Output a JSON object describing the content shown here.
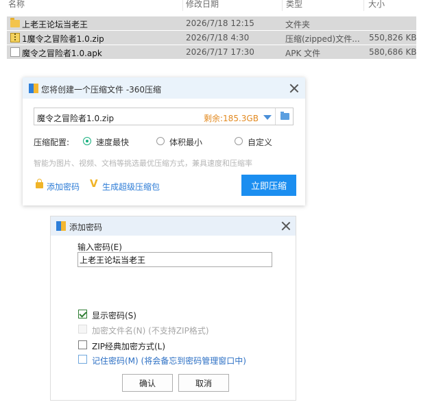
{
  "explorer": {
    "columns": [
      "名称",
      "修改日期",
      "类型",
      "大小"
    ],
    "files": [
      {
        "name": "上老王论坛当老王",
        "date": "2026/7/18 12:15",
        "type": "文件夹",
        "size": "",
        "icon": "folder-icon"
      },
      {
        "name": "1魔令之冒险者1.0.zip",
        "date": "2026/7/18 4:30",
        "type": "压缩(zipped)文件...",
        "size": "550,826 KB",
        "icon": "zip-icon"
      },
      {
        "name": "魔令之冒险者1.0.apk",
        "date": "2026/7/17 17:30",
        "type": "APK 文件",
        "size": "580,686 KB",
        "icon": "document-icon"
      }
    ]
  },
  "compress_dialog": {
    "title": "您将创建一个压缩文件 -360压缩",
    "filename": "魔令之冒险者1.0.zip",
    "remaining": "剩余:185.3GB",
    "config_label": "压缩配置:",
    "options": [
      "速度最快",
      "体积最小",
      "自定义"
    ],
    "selected_option": "速度最快",
    "hint": "智能为图片、视频、文档等挑选最优压缩方式，兼具速度和压缩率",
    "add_password": "添加密码",
    "super_compress": "生成超级压缩包",
    "compress_now": "立即压缩",
    "accent_color": "#1b8ef0"
  },
  "password_dialog": {
    "title": "添加密码",
    "input_label": "输入密码(E)",
    "password_value": "上老王论坛当老王",
    "checkboxes": [
      {
        "label": "显示密码(S)",
        "checked": true,
        "enabled": true
      },
      {
        "label": "加密文件名(N) (不支持ZIP格式)",
        "checked": false,
        "enabled": false
      },
      {
        "label": "ZIP经典加密方式(L)",
        "checked": false,
        "enabled": true
      },
      {
        "label": "记住密码(M) (将会备忘到密码管理窗口中)",
        "checked": false,
        "enabled": true
      }
    ],
    "ok_label": "确认",
    "cancel_label": "取消"
  }
}
